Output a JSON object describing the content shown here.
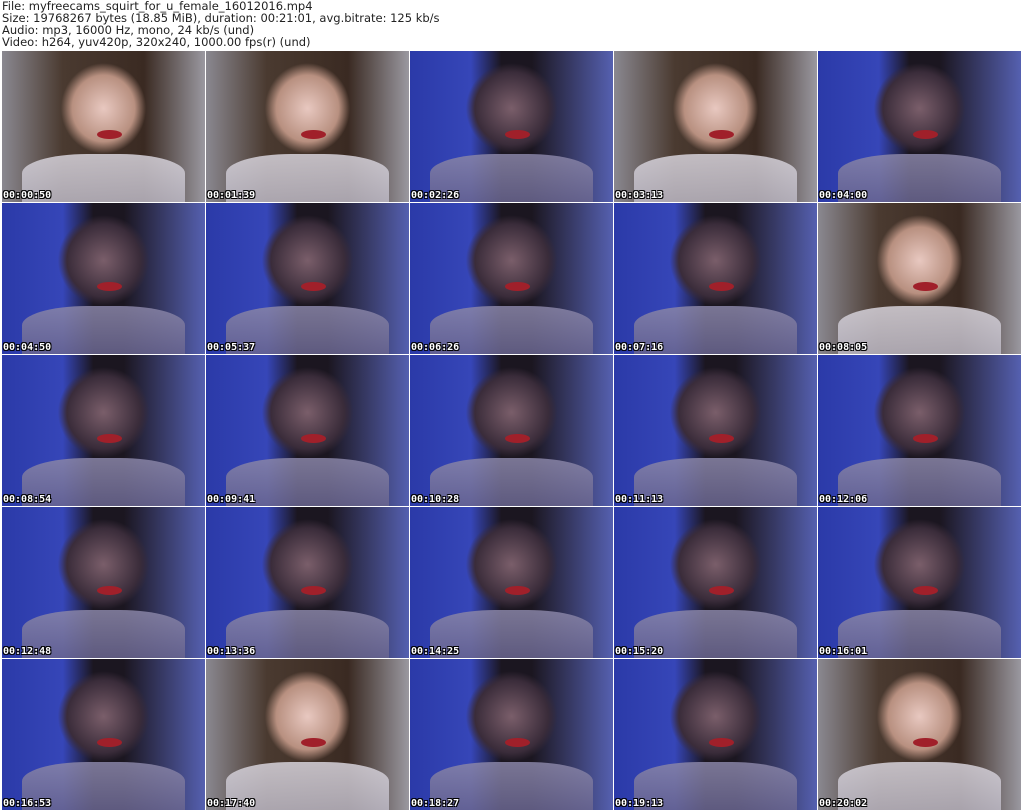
{
  "header": {
    "file": "File: myfreecams_squirt_for_u_female_16012016.mp4",
    "size": "Size: 19768267 bytes (18.85 MiB), duration: 00:21:01, avg.bitrate: 125 kb/s",
    "audio": "Audio: mp3, 16000 Hz, mono, 24 kb/s (und)",
    "video": "Video: h264, yuv420p, 320x240, 1000.00 fps(r) (und)"
  },
  "thumbnails": [
    {
      "time": "00:00:50",
      "tone": "warm"
    },
    {
      "time": "00:01:39",
      "tone": "warm"
    },
    {
      "time": "00:02:26",
      "tone": "blue"
    },
    {
      "time": "00:03:13",
      "tone": "warm"
    },
    {
      "time": "00:04:00",
      "tone": "blue"
    },
    {
      "time": "00:04:50",
      "tone": "blue"
    },
    {
      "time": "00:05:37",
      "tone": "blue"
    },
    {
      "time": "00:06:26",
      "tone": "blue"
    },
    {
      "time": "00:07:16",
      "tone": "blue"
    },
    {
      "time": "00:08:05",
      "tone": "warm"
    },
    {
      "time": "00:08:54",
      "tone": "blue"
    },
    {
      "time": "00:09:41",
      "tone": "blue"
    },
    {
      "time": "00:10:28",
      "tone": "blue"
    },
    {
      "time": "00:11:13",
      "tone": "blue"
    },
    {
      "time": "00:12:06",
      "tone": "blue"
    },
    {
      "time": "00:12:48",
      "tone": "blue"
    },
    {
      "time": "00:13:36",
      "tone": "blue"
    },
    {
      "time": "00:14:25",
      "tone": "blue"
    },
    {
      "time": "00:15:20",
      "tone": "blue"
    },
    {
      "time": "00:16:01",
      "tone": "blue"
    },
    {
      "time": "00:16:53",
      "tone": "blue"
    },
    {
      "time": "00:17:40",
      "tone": "warm"
    },
    {
      "time": "00:18:27",
      "tone": "blue"
    },
    {
      "time": "00:19:13",
      "tone": "blue"
    },
    {
      "time": "00:20:02",
      "tone": "warm"
    }
  ]
}
